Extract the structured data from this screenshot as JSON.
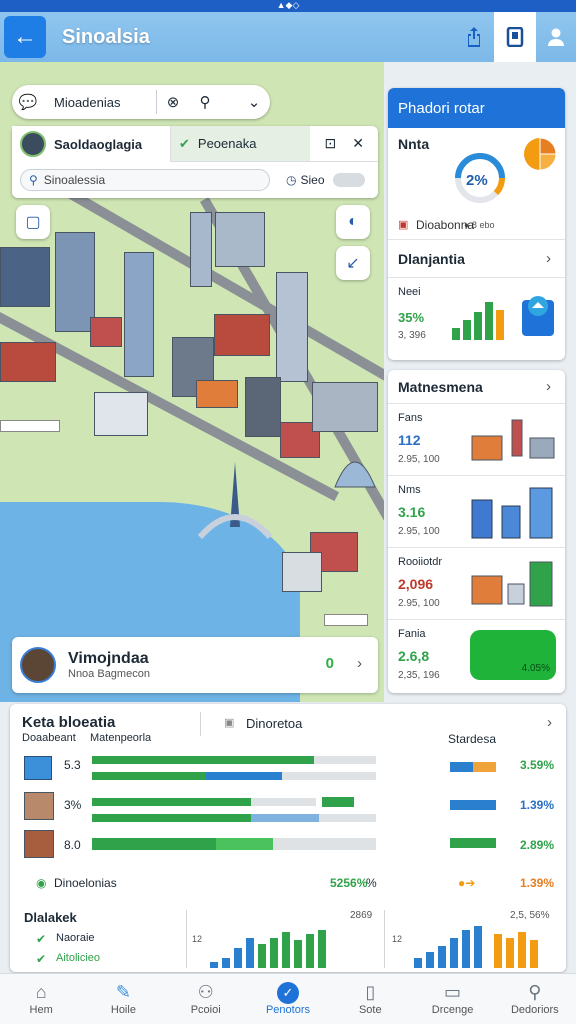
{
  "statusbar": {
    "text": "▲◆◇"
  },
  "appbar": {
    "title": "Sinoalsia"
  },
  "map_search": {
    "label": "Mioadenias"
  },
  "tabs": [
    {
      "label": "Saoldaoglagia"
    },
    {
      "label": "Peoenaka"
    }
  ],
  "sub_search": {
    "placeholder": "Sinoalessia",
    "value": "Sieo"
  },
  "profile": {
    "name": "Vimojndaa",
    "subtitle": "Nnoa Bagmecon",
    "count": "0"
  },
  "right_panel": {
    "header": "Phadori rotar",
    "card1": {
      "label": "Nnta",
      "gauge_value": "2%",
      "gauge_caption": "● 8 ebo",
      "footer": "Dioabonna"
    },
    "card2": {
      "label": "Dlanjantia"
    },
    "card3": {
      "label": "Neei",
      "value": "35%",
      "sub": "3, 396"
    }
  },
  "list_panel": {
    "header": "Matnesmena",
    "items": [
      {
        "label": "Fans",
        "value": "112",
        "sub": "2.95, 100"
      },
      {
        "label": "Nms",
        "value": "3.16",
        "sub": "2.95, 100"
      },
      {
        "label": "Rooiiotdr",
        "value": "2,096",
        "sub": "2.95, 100"
      },
      {
        "label": "Fania",
        "value": "2.6,8",
        "sub": "2,35, 196",
        "badge": "4.05%"
      }
    ]
  },
  "stats": {
    "title": "Keta bloeatia",
    "col1": "Doaabeant",
    "col2": "Matenpeorla",
    "tab_label": "Dinoretoa",
    "right_header": "Stardesa",
    "rows": [
      {
        "value": "5.3",
        "fill1": 0.78,
        "fill2": 0.67,
        "pct": "3.59%"
      },
      {
        "value": "3%",
        "fill1": 0.56,
        "fill2": 0.8,
        "pct": "1.39%"
      },
      {
        "value": "8.0",
        "fill1": 0.44,
        "fill2": 0.2,
        "pct": "2.89%"
      }
    ],
    "summary_label": "Dinoelonias",
    "summary_value": "5256%",
    "summary_unit": "%",
    "summary_right": "1.39%",
    "section2_title": "Dlalakek",
    "checks": [
      "Naoraie",
      "Aitolicieo"
    ],
    "axis_top_left": "2869",
    "axis_top_right": "2,5, 56%",
    "axis_left_tick": "12",
    "axis_left_tick2": "12"
  },
  "nav": [
    {
      "label": "Hem",
      "icon": "home-icon"
    },
    {
      "label": "Hoile",
      "icon": "pencil-icon"
    },
    {
      "label": "Pcoioi",
      "icon": "person-icon"
    },
    {
      "label": "Penotors",
      "icon": "shield-icon",
      "active": true
    },
    {
      "label": "Sote",
      "icon": "device-icon"
    },
    {
      "label": "Drcenge",
      "icon": "monitor-icon"
    },
    {
      "label": "Dedoriors",
      "icon": "person-outline-icon"
    }
  ],
  "colors": {
    "accent": "#1f73d8",
    "green": "#2fa24a",
    "orange": "#f39c12"
  }
}
